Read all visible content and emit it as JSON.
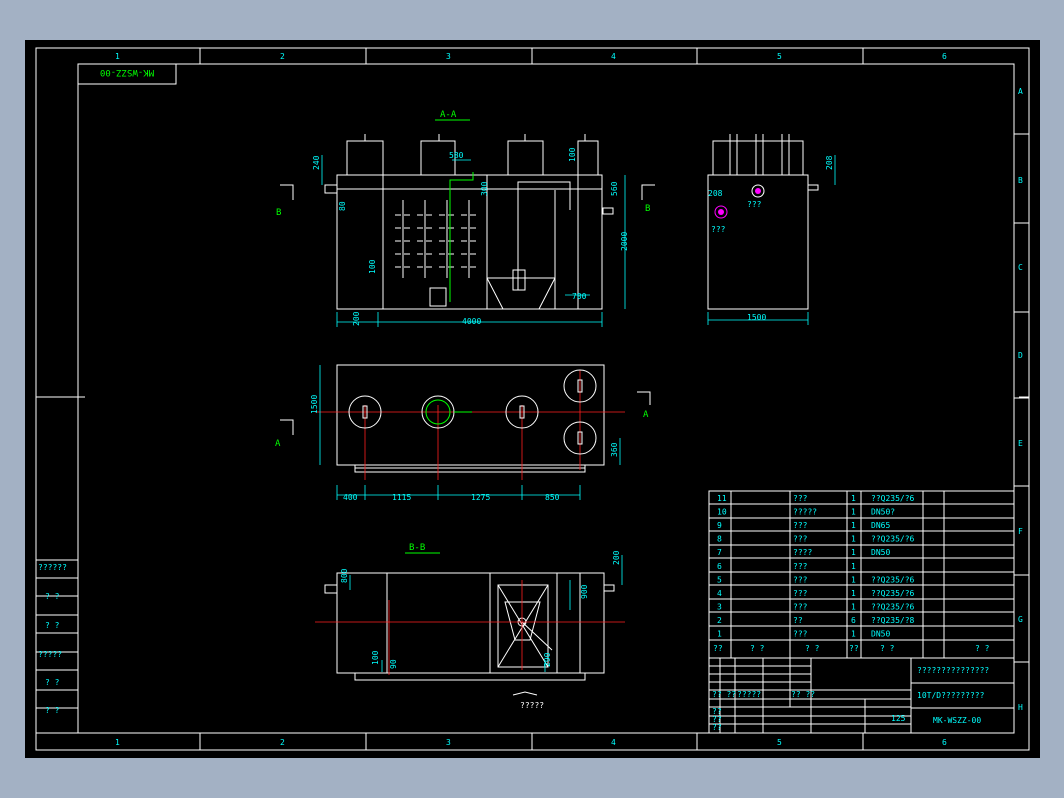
{
  "drawing": {
    "top_label": "MK-WSZZ-00",
    "grid_cols": [
      "1",
      "2",
      "3",
      "4",
      "5",
      "6"
    ],
    "grid_rows": [
      "A",
      "B",
      "C",
      "D",
      "E",
      "F",
      "G",
      "H"
    ],
    "section_aa": "A-A",
    "section_bb": "B-B",
    "cut_b": "B",
    "cut_a": "A",
    "dims_aa": [
      "240",
      "580",
      "100",
      "100",
      "560",
      "300",
      "80",
      "2000",
      "100",
      "200",
      "700",
      "4000"
    ],
    "dims_side": [
      "208",
      "208",
      "1500"
    ],
    "side_notes": [
      "???",
      "???"
    ],
    "dims_plan": [
      "1500",
      "400",
      "1115",
      "1275",
      "850",
      "360"
    ],
    "dims_bb": [
      "200",
      "800",
      "900",
      "100",
      "90",
      "290"
    ],
    "bb_caption": "?????",
    "left_stamps": [
      "??????",
      "? ?",
      "? ?",
      "?????",
      "? ?",
      "? ?"
    ]
  },
  "bom": {
    "rows": [
      {
        "no": "11",
        "name": "???",
        "qty": "1",
        "mat": "??Q235/?6"
      },
      {
        "no": "10",
        "name": "?????",
        "qty": "1",
        "mat": "DN50?"
      },
      {
        "no": "9",
        "name": "???",
        "qty": "1",
        "mat": "DN65"
      },
      {
        "no": "8",
        "name": "???",
        "qty": "1",
        "mat": "??Q235/?6"
      },
      {
        "no": "7",
        "name": "????",
        "qty": "1",
        "mat": "DN50"
      },
      {
        "no": "6",
        "name": "???",
        "qty": "1",
        "mat": ""
      },
      {
        "no": "5",
        "name": "???",
        "qty": "1",
        "mat": "??Q235/?6"
      },
      {
        "no": "4",
        "name": "???",
        "qty": "1",
        "mat": "??Q235/?6"
      },
      {
        "no": "3",
        "name": "???",
        "qty": "1",
        "mat": "??Q235/?6"
      },
      {
        "no": "2",
        "name": "??",
        "qty": "6",
        "mat": "??Q235/?8"
      },
      {
        "no": "1",
        "name": "???",
        "qty": "1",
        "mat": "DN50"
      }
    ],
    "header": [
      "??",
      "? ?",
      "? ?",
      "??",
      "? ?",
      "? ?"
    ]
  },
  "title_block": {
    "company": "???????????????",
    "drawing_name": "10T/D?????????",
    "drawing_no": "MK-WSZZ-00",
    "scale": "125",
    "row_labels": [
      "?? ??",
      "?????",
      "?? ??",
      "??",
      "??",
      "??"
    ]
  }
}
